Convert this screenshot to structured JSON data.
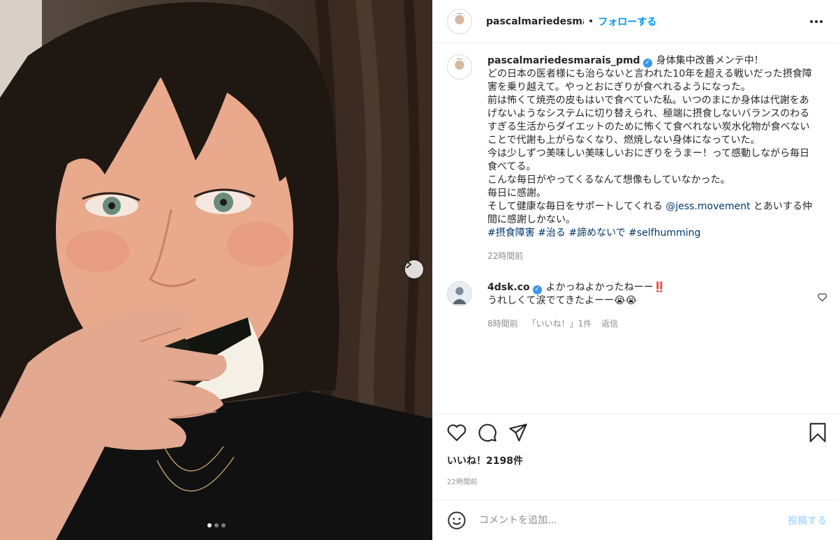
{
  "post": {
    "username_truncated": "pascalmariedesmarais_pmd",
    "follow_label": "フォローする",
    "separator": "•"
  },
  "caption": {
    "username": "pascalmariedesmarais_pmd",
    "verified_mark": "✓",
    "lines": [
      "身体集中改善メンテ中！",
      "どの日本の医者様にも治らないと言われた10年を超える戦いだった摂食障害を乗り越えて。やっとおにぎりが食べれるようになった。",
      "前は怖くて焼売の皮もはいで食べていた私。いつのまにか身体は代謝をあげないようなシステムに切り替えられ、極端に摂食しないバランスのわるすぎる生活からダイエットのために怖くて食べれない炭水化物が食べないことで代謝も上がらなくなり、燃焼しない身体になっていた。",
      "今は少しずつ美味しい美味しいおにぎりをうまー！って感動しながら毎日食べてる。",
      "こんな毎日がやってくるなんて想像もしていなかった。",
      "毎日に感謝。"
    ],
    "last_line_prefix": "そして健康な毎日をサポートしてくれる ",
    "mention": "@jess.movement",
    "last_line_suffix": " とあいする仲間に感謝しかない。",
    "hashtags": [
      "#摂食障害",
      "#治る",
      "#諦めないで",
      "#selfhumming"
    ],
    "time": "22時間前"
  },
  "reply": {
    "username": "4dsk.co",
    "verified_mark": "✓",
    "text_line1": "よかっねよかったねーー‼️",
    "text_line2": "うれしくて涙でてきたよーー😭😭",
    "time": "8時間前",
    "likes": "「いいね！」1件",
    "reply_label": "返信"
  },
  "actions": {
    "likes_text": "いいね！2198件",
    "time": "22時間前"
  },
  "comment_box": {
    "placeholder": "コメントを追加...",
    "post_label": "投稿する"
  },
  "carousel": {
    "total": 3,
    "active": 1
  }
}
